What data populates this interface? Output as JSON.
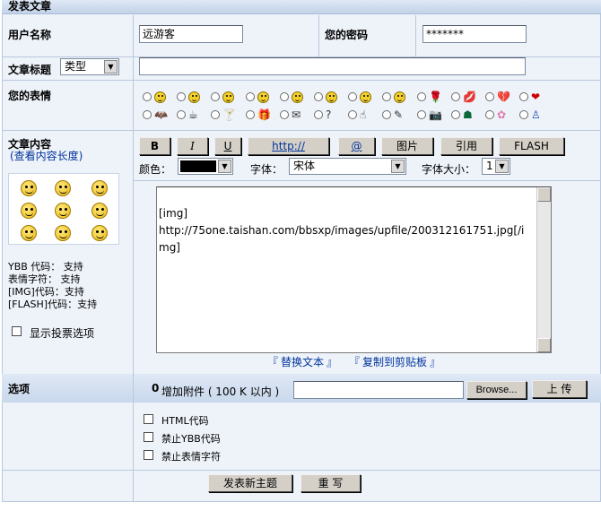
{
  "header": {
    "title": "发表文章"
  },
  "user": {
    "username_label": "用户名称",
    "username_value": "远游客",
    "password_label": "您的密码",
    "password_value": "*******"
  },
  "article": {
    "title_label": "文章标题",
    "type_select": "类型",
    "title_value": ""
  },
  "emotion": {
    "label": "您的表情"
  },
  "content": {
    "label": "文章内容",
    "length_link": "(查看内容长度)",
    "ybb_line": "YBB 代码： 支持",
    "emoticon_line": "表情字符： 支持",
    "img_line": "[IMG]代码：支持",
    "flash_line": "[FLASH]代码：支持",
    "vote_label": "显示投票选项",
    "body": "[img]\nhttp://75one.taishan.com/bbsxp/images/upfile/200312161751.jpg[/img]"
  },
  "toolbar": {
    "bold": "B",
    "italic": "I",
    "underline": "U",
    "url": "http://",
    "email": "@",
    "image": "图片",
    "quote": "引用",
    "flash": "FLASH",
    "color_label": "颜色：",
    "font_label": "字体：",
    "font_value": "宋体",
    "size_label": "字体大小：",
    "size_value": "1"
  },
  "links": {
    "replace": "替换文本",
    "copy": "复制到剪贴板",
    "left_bracket": "『",
    "right_bracket": "』"
  },
  "options": {
    "label": "选项",
    "attach_label": "增加附件 ( 100 K 以内 )",
    "browse": "Browse...",
    "upload": "上 传",
    "html_code": "HTML代码",
    "disable_ybb": "禁止YBB代码",
    "disable_emoticon": "禁止表情字符"
  },
  "actions": {
    "submit": "发表新主题",
    "reset": "重 写"
  }
}
